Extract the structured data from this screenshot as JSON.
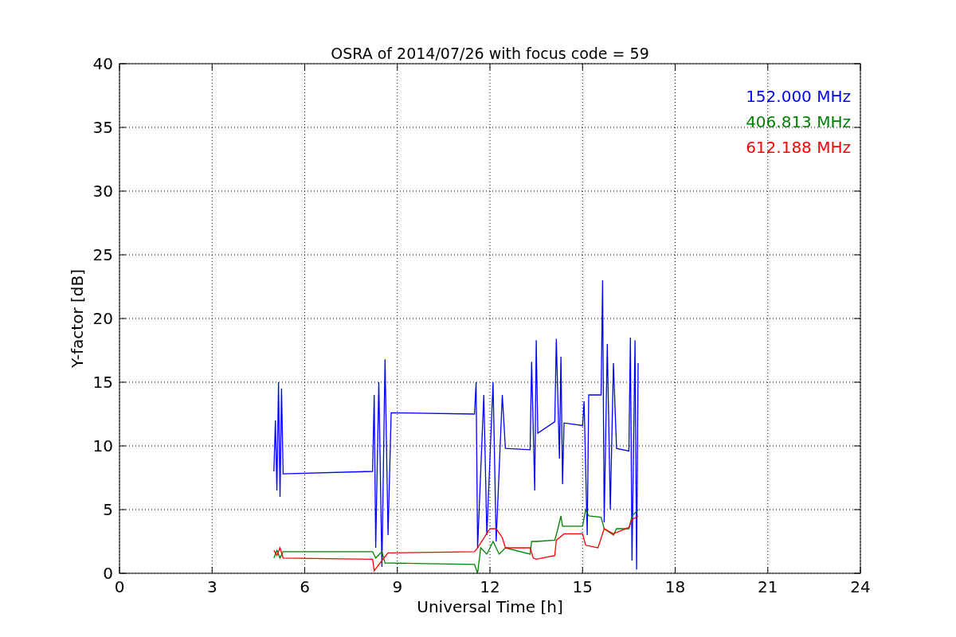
{
  "chart_data": {
    "type": "line",
    "grid": true,
    "title": "OSRA of 2014/07/26 with focus code = 59",
    "xlabel": "Universal Time [h]",
    "ylabel": "Y-factor [dB]",
    "xlim": [
      0,
      24
    ],
    "ylim": [
      0,
      40
    ],
    "xticks": [
      0,
      3,
      6,
      9,
      12,
      15,
      18,
      21,
      24
    ],
    "yticks": [
      0,
      5,
      10,
      15,
      20,
      25,
      30,
      35,
      40
    ],
    "series": [
      {
        "name": "152.000 MHz",
        "color": "#0000ff",
        "x": [
          5.0,
          5.05,
          5.1,
          5.15,
          5.2,
          5.25,
          5.3,
          8.2,
          8.25,
          8.3,
          8.4,
          8.5,
          8.6,
          8.7,
          8.8,
          11.5,
          11.55,
          11.6,
          11.8,
          11.9,
          12.1,
          12.2,
          12.4,
          12.5,
          13.3,
          13.35,
          13.45,
          13.5,
          13.55,
          14.1,
          14.15,
          14.25,
          14.3,
          14.35,
          14.4,
          15.0,
          15.05,
          15.15,
          15.2,
          15.6,
          15.65,
          15.7,
          15.8,
          15.9,
          16.0,
          16.1,
          16.5,
          16.55,
          16.6,
          16.7,
          16.75,
          16.8
        ],
        "values": [
          8,
          12,
          6.5,
          15,
          6,
          14.5,
          7.8,
          8,
          14,
          2,
          15,
          0.5,
          16.8,
          3,
          12.6,
          12.5,
          15,
          2,
          14,
          3,
          15,
          2.5,
          14,
          9.8,
          9.7,
          16.6,
          6.5,
          18.3,
          11,
          11.9,
          18.4,
          9,
          17,
          7,
          11.8,
          11.6,
          13.5,
          3,
          14,
          14,
          23,
          4,
          18,
          5,
          16.5,
          9.8,
          9.6,
          18.5,
          1,
          18.3,
          0.3,
          16.5
        ]
      },
      {
        "name": "406.813 MHz",
        "color": "#008000",
        "x": [
          5.0,
          5.1,
          5.2,
          5.3,
          8.2,
          8.3,
          8.5,
          8.6,
          8.8,
          11.5,
          11.6,
          11.7,
          11.9,
          12.1,
          12.3,
          12.5,
          13.3,
          13.35,
          13.5,
          14.1,
          14.2,
          14.3,
          14.35,
          15.0,
          15.1,
          15.2,
          15.6,
          15.7,
          16.0,
          16.1,
          16.5,
          16.6,
          16.8
        ],
        "values": [
          1.2,
          1.8,
          1.2,
          1.7,
          1.7,
          1.2,
          1.7,
          0.8,
          0.8,
          0.7,
          0,
          2,
          1.5,
          2.5,
          1.5,
          2,
          1.5,
          2.5,
          2.5,
          2.6,
          3.5,
          4.5,
          3.7,
          3.7,
          5,
          4.5,
          4.4,
          3.5,
          3,
          3.5,
          3.5,
          4.5,
          5
        ]
      },
      {
        "name": "612.188 MHz",
        "color": "#ff0000",
        "x": [
          5.0,
          5.1,
          5.2,
          5.3,
          8.2,
          8.25,
          8.5,
          8.7,
          11.5,
          11.6,
          12.0,
          12.2,
          12.4,
          12.5,
          13.3,
          13.4,
          13.5,
          14.1,
          14.15,
          14.4,
          15.0,
          15.1,
          15.3,
          15.5,
          15.7,
          16.0,
          16.5,
          16.6,
          16.8
        ],
        "values": [
          1.8,
          1.4,
          2,
          1.2,
          1.1,
          0.2,
          1,
          1.6,
          1.7,
          2,
          3.5,
          3.5,
          2.8,
          2,
          2,
          1.2,
          1.1,
          1.4,
          2.6,
          3.1,
          3.1,
          2.2,
          2.1,
          2,
          3.5,
          3.1,
          3.6,
          4.2,
          4.5
        ]
      }
    ]
  }
}
